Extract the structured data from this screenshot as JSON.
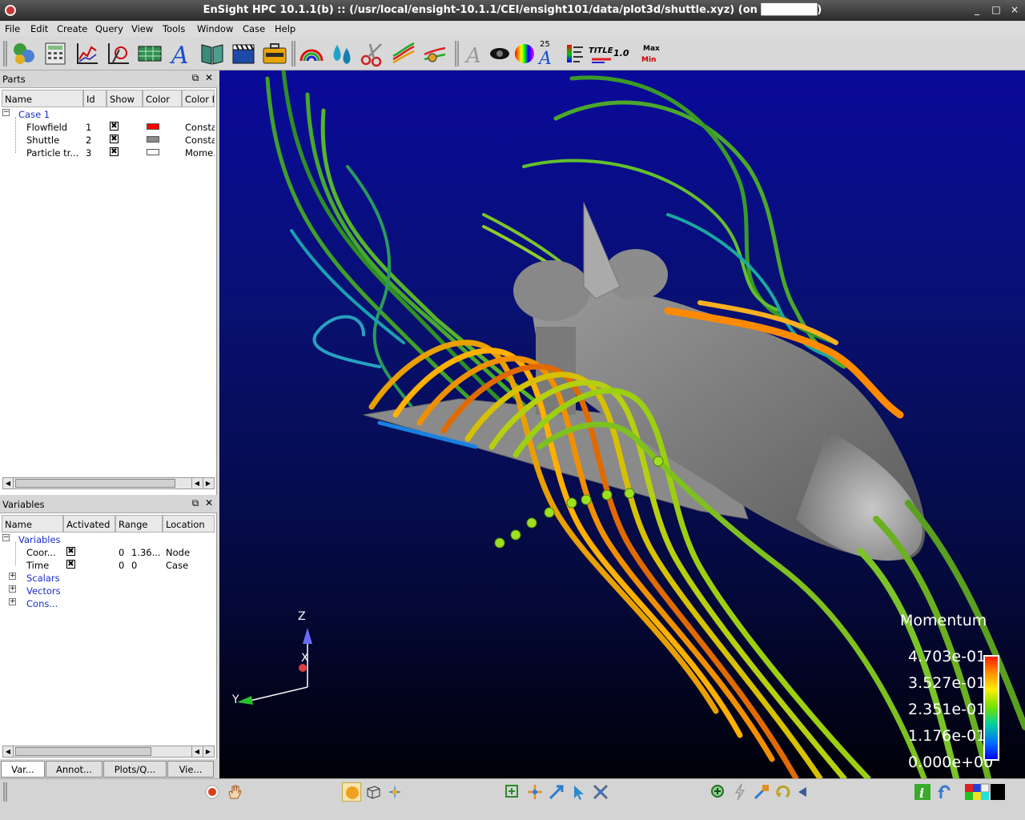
{
  "window": {
    "title": "EnSight HPC 10.1.1(b) ::  (/usr/local/ensight-10.1.1/CEI/ensight101/data/plot3d/shuttle.xyz) (on ███████)",
    "minimize": "_",
    "maximize": "□",
    "close": "×"
  },
  "menu": [
    "File",
    "Edit",
    "Create",
    "Query",
    "View",
    "Tools",
    "Window",
    "Case",
    "Help"
  ],
  "toolbar": {
    "icons": [
      "parts-icon",
      "calculator-icon",
      "plot-icon",
      "query-icon",
      "table-icon",
      "annotation-text-icon",
      "book-icon",
      "clapper-icon",
      "briefcase-icon",
      "rainbow-icon",
      "drops-icon",
      "scissors-icon",
      "streamline-icon",
      "particle-trace-icon",
      "text-icon",
      "eye-icon",
      "color-wheel-icon",
      "font-size-icon",
      "legend-icon",
      "title-icon",
      "value-icon",
      "minmax-icon"
    ],
    "font_size_label": "25",
    "title_label": "TITLE",
    "value_label": "1.0",
    "max_label": "Max",
    "min_label": "Min"
  },
  "parts_panel": {
    "title": "Parts",
    "columns": [
      "Name",
      "Id",
      "Show",
      "Color",
      "Color I"
    ],
    "case": "Case 1",
    "rows": [
      {
        "name": "Flowfield",
        "id": "1",
        "show": "✖",
        "color": "#ff0000",
        "color_by": "Consta"
      },
      {
        "name": "Shuttle",
        "id": "2",
        "show": "✖",
        "color": "#8a8a8a",
        "color_by": "Consta"
      },
      {
        "name": "Particle tr...",
        "id": "3",
        "show": "✖",
        "color": "#ffffff",
        "color_by": "Mome..."
      }
    ]
  },
  "variables_panel": {
    "title": "Variables",
    "columns": [
      "Name",
      "Activated",
      "Range",
      "Location"
    ],
    "root": "Variables",
    "rows": [
      {
        "name": "Coor...",
        "activated": "✖",
        "range_min": "0",
        "range_max": "1.36...",
        "location": "Node"
      },
      {
        "name": "Time",
        "activated": "✖",
        "range_min": "0",
        "range_max": "0",
        "location": "Case"
      }
    ],
    "groups": [
      "Scalars",
      "Vectors",
      "Cons..."
    ]
  },
  "tabs": [
    "Var...",
    "Annot...",
    "Plots/Q...",
    "Vie..."
  ],
  "viewport": {
    "legend_title": "Momentum",
    "legend_values": [
      "4.703e-01",
      "3.527e-01",
      "2.351e-01",
      "1.176e-01",
      "0.000e+00"
    ],
    "axis": {
      "z": "Z",
      "x": "X",
      "y": "Y"
    },
    "background_top": "#0a0a9a",
    "background_bottom": "#000008"
  }
}
